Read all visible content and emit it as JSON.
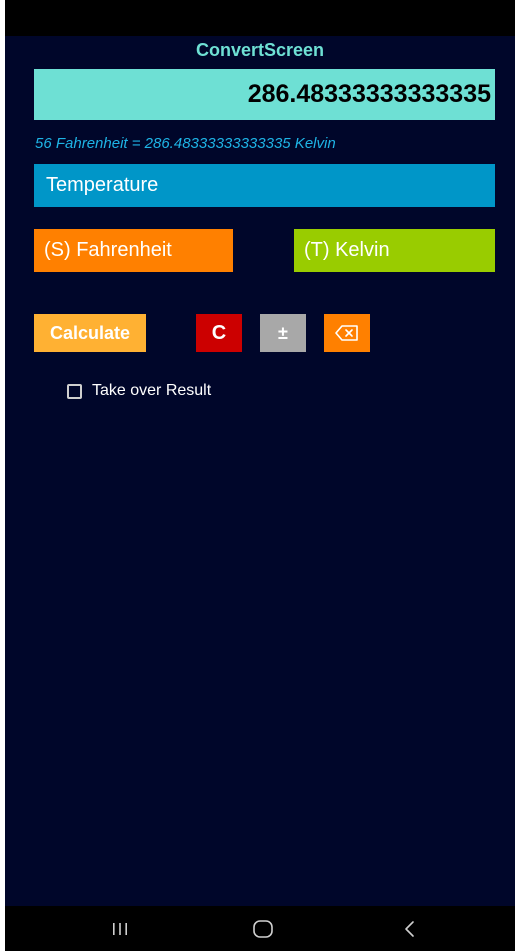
{
  "app": {
    "title": "ConvertScreen"
  },
  "result": {
    "value": "286.48333333333335"
  },
  "formula": {
    "text": "56 Fahrenheit = 286.48333333333335 Kelvin"
  },
  "category": {
    "label": "Temperature"
  },
  "units": {
    "source_label": "(S) Fahrenheit",
    "target_label": "(T) Kelvin"
  },
  "actions": {
    "calculate_label": "Calculate",
    "clear_label": "C",
    "sign_label": "±",
    "backspace_icon": "backspace-icon"
  },
  "options": {
    "take_over_label": "Take over Result",
    "take_over_checked": false
  },
  "navigation": {
    "recents_icon": "recents-icon",
    "home_icon": "home-icon",
    "back_icon": "back-icon"
  },
  "colors": {
    "background": "#00062a",
    "title": "#6ee0d4",
    "result_bg": "#6ee0d4",
    "formula_text": "#1eb4e6",
    "category_bg": "#0096c8",
    "source_bg": "#ff8000",
    "target_bg": "#99cc00",
    "calculate_bg": "#ffb133",
    "clear_bg": "#cc0000",
    "sign_bg": "#a8a8a8",
    "backspace_bg": "#ff8000"
  }
}
